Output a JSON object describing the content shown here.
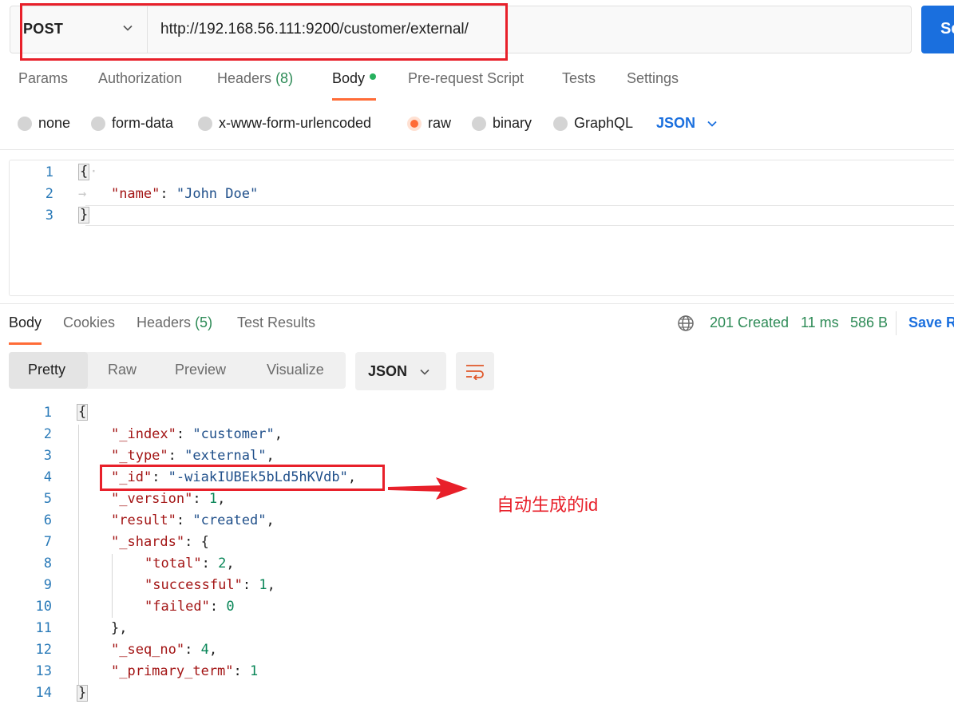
{
  "request": {
    "method": "POST",
    "url": "http://192.168.56.111:9200/customer/external/",
    "send_label": "Se",
    "tabs": {
      "params": "Params",
      "authorization": "Authorization",
      "headers": "Headers",
      "headers_count": "(8)",
      "body": "Body",
      "pre_request": "Pre-request Script",
      "tests": "Tests",
      "settings": "Settings"
    },
    "body_types": {
      "none": "none",
      "form_data": "form-data",
      "urlencoded": "x-www-form-urlencoded",
      "raw": "raw",
      "binary": "binary",
      "graphql": "GraphQL",
      "selected": "raw",
      "language": "JSON"
    },
    "editor": {
      "line_numbers": [
        "1",
        "2",
        "3"
      ],
      "open_brace": "{",
      "key": "\"name\"",
      "colon": ": ",
      "value": "\"John Doe\"",
      "close_brace": "}"
    }
  },
  "response": {
    "tabs": {
      "body": "Body",
      "cookies": "Cookies",
      "headers": "Headers",
      "headers_count": "(5)",
      "test_results": "Test Results"
    },
    "status": "201 Created",
    "time": "11 ms",
    "size": "586 B",
    "save_label": "Save R",
    "views": {
      "pretty": "Pretty",
      "raw": "Raw",
      "preview": "Preview",
      "visualize": "Visualize"
    },
    "format": "JSON",
    "line_numbers": [
      "1",
      "2",
      "3",
      "4",
      "5",
      "6",
      "7",
      "8",
      "9",
      "10",
      "11",
      "12",
      "13",
      "14"
    ],
    "json": {
      "open": "{",
      "index_key": "\"_index\"",
      "index_val": "\"customer\"",
      "type_key": "\"_type\"",
      "type_val": "\"external\"",
      "id_key": "\"_id\"",
      "id_val": "\"-wiakIUBEk5bLd5hKVdb\"",
      "version_key": "\"_version\"",
      "version_val": "1",
      "result_key": "\"result\"",
      "result_val": "\"created\"",
      "shards_key": "\"_shards\"",
      "shards_open": "{",
      "total_key": "\"total\"",
      "total_val": "2",
      "successful_key": "\"successful\"",
      "successful_val": "1",
      "failed_key": "\"failed\"",
      "failed_val": "0",
      "shards_close": "},",
      "seq_key": "\"_seq_no\"",
      "seq_val": "4",
      "term_key": "\"_primary_term\"",
      "term_val": "1",
      "close": "}"
    }
  },
  "annotation": {
    "text": "自动生成的id",
    "color": "#e8202a"
  },
  "colors": {
    "accent": "#ff6c37",
    "brand_blue": "#1a6fde",
    "success_green": "#2e8b57",
    "highlight_red": "#e8202a"
  }
}
